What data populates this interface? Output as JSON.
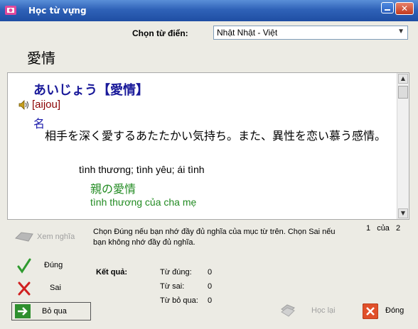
{
  "window": {
    "title": "Học từ vựng"
  },
  "dictionary": {
    "label": "Chọn từ điển:",
    "selected": "Nhật Nhật - Việt"
  },
  "word": "愛情",
  "entry": {
    "reading": "あいじょう【愛情】",
    "romaji": "[aijou]",
    "pos": "名",
    "definition": "相手を深く愛するあたたかい気持ち。また、異性を恋い慕う感情。",
    "meaning": "tình thương; tình yêu; ái tình",
    "example_jp": "親の愛情",
    "example_vi": "tình thương của cha mẹ"
  },
  "controls": {
    "show_meaning": "Xem nghĩa",
    "instruction": "Chọn Đúng nếu bạn nhớ đầy đủ nghĩa của mục từ trên. Chọn Sai nếu bạn không nhớ đầy đủ nghĩa.",
    "progress_current": "1",
    "progress_of": "của",
    "progress_total": "2",
    "correct_label": "Đúng",
    "wrong_label": "Sai",
    "skip_label": "Bỏ qua",
    "relearn_label": "Học lại",
    "close_label": "Đóng"
  },
  "results": {
    "title": "Kết quả:",
    "correct_label": "Từ đúng:",
    "correct_value": "0",
    "wrong_label": "Từ sai:",
    "wrong_value": "0",
    "skipped_label": "Từ bỏ qua:",
    "skipped_value": "0"
  },
  "colors": {
    "titlebar": "#2f62b8",
    "reading": "#1a1a9a",
    "romaji": "#8b0000",
    "example": "#228b22"
  }
}
